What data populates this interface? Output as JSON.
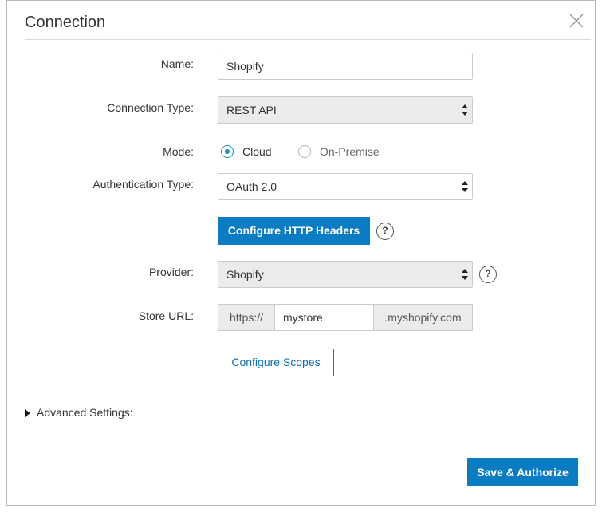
{
  "dialog": {
    "title": "Connection"
  },
  "form": {
    "name_label": "Name:",
    "name_value": "Shopify",
    "connection_type_label": "Connection Type:",
    "connection_type_value": "REST API",
    "mode_label": "Mode:",
    "mode_options": [
      {
        "label": "Cloud",
        "selected": true
      },
      {
        "label": "On-Premise",
        "selected": false
      }
    ],
    "auth_type_label": "Authentication Type:",
    "auth_type_value": "OAuth 2.0",
    "configure_headers_label": "Configure HTTP Headers",
    "help_glyph": "?",
    "provider_label": "Provider:",
    "provider_value": "Shopify",
    "store_url_label": "Store URL:",
    "store_url_prefix": "https://",
    "store_url_value": "mystore",
    "store_url_suffix": ".myshopify.com",
    "configure_scopes_label": "Configure Scopes"
  },
  "advanced": {
    "label": "Advanced Settings:"
  },
  "footer": {
    "save_label": "Save & Authorize"
  },
  "colors": {
    "accent": "#0a7cc4",
    "radio_selected": "#1a8ccf"
  },
  "icons": {
    "close": "close-icon",
    "select_arrows": "chevron-updown-icon",
    "help": "help-icon",
    "expand": "triangle-right-icon"
  }
}
